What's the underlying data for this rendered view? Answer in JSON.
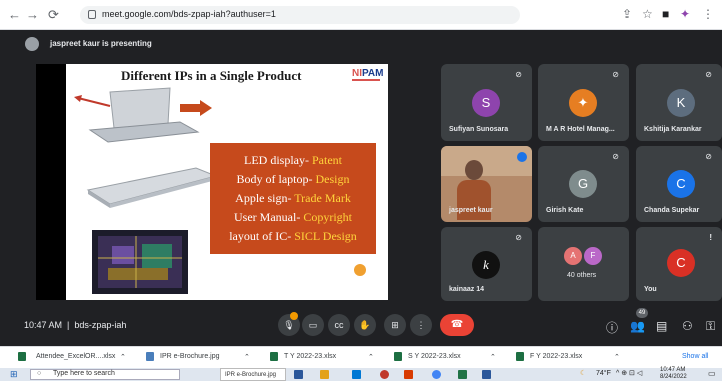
{
  "browser": {
    "url": "meet.google.com/bds-zpap-iah?authuser=1",
    "back_icon": "arrow-left-icon",
    "forward_icon": "arrow-right-icon",
    "reload_icon": "reload-icon"
  },
  "presenter": {
    "text": "jaspreet kaur is presenting"
  },
  "slide": {
    "title": "Different IPs in a Single Product",
    "logo_prefix": "NI",
    "logo_suffix": "PAM",
    "lines": [
      {
        "label": "LED display- ",
        "value": "Patent"
      },
      {
        "label": "Body of laptop- ",
        "value": "Design"
      },
      {
        "label": "Apple sign- ",
        "value": "Trade Mark"
      },
      {
        "label": "User Manual- ",
        "value": "Copyright"
      },
      {
        "label": "layout of IC- ",
        "value": "SICL Design"
      }
    ]
  },
  "participants": [
    {
      "name": "Sufiyan Sunosara",
      "initial": "S",
      "color": "#8e44ad"
    },
    {
      "name": "M A R Hotel Manag...",
      "initial": "",
      "color": "#e67e22"
    },
    {
      "name": "Kshitija Karankar",
      "initial": "K",
      "color": "#5d6d7e"
    },
    {
      "name": "jaspreet kaur",
      "initial": "",
      "color": ""
    },
    {
      "name": "Girish Kate",
      "initial": "G",
      "color": "#7f8c8d"
    },
    {
      "name": "Chanda Supekar",
      "initial": "C",
      "color": "#1a73e8"
    },
    {
      "name": "kainaaz 14",
      "initial": "",
      "color": "#333333"
    },
    {
      "name": "40 others",
      "initial": "A",
      "initial2": "F",
      "color": "#e57373",
      "color2": "#ba68c8"
    },
    {
      "name": "You",
      "initial": "C",
      "color": "#d93025"
    }
  ],
  "meeting": {
    "time": "10:47 AM",
    "separator": "|",
    "code": "bds-zpap-iah",
    "participant_count": "49"
  },
  "downloads": [
    {
      "file": "Attendee_ExcelOR....xlsx",
      "color": "#1d6f42"
    },
    {
      "file": "IPR e-Brochure.jpg",
      "color": "#4a7ebb"
    },
    {
      "file": "T Y 2022-23.xlsx",
      "color": "#1d6f42"
    },
    {
      "file": "S Y 2022-23.xlsx",
      "color": "#1d6f42"
    },
    {
      "file": "F Y 2022-23.xlsx",
      "color": "#1d6f42"
    }
  ],
  "show_all": "Show all",
  "taskbar": {
    "search_placeholder": "Type here to search",
    "thumb_label": "IPR e-Brochure.jpg",
    "temperature": "74°F",
    "clock_time": "10:47 AM",
    "clock_date": "8/24/2022"
  }
}
